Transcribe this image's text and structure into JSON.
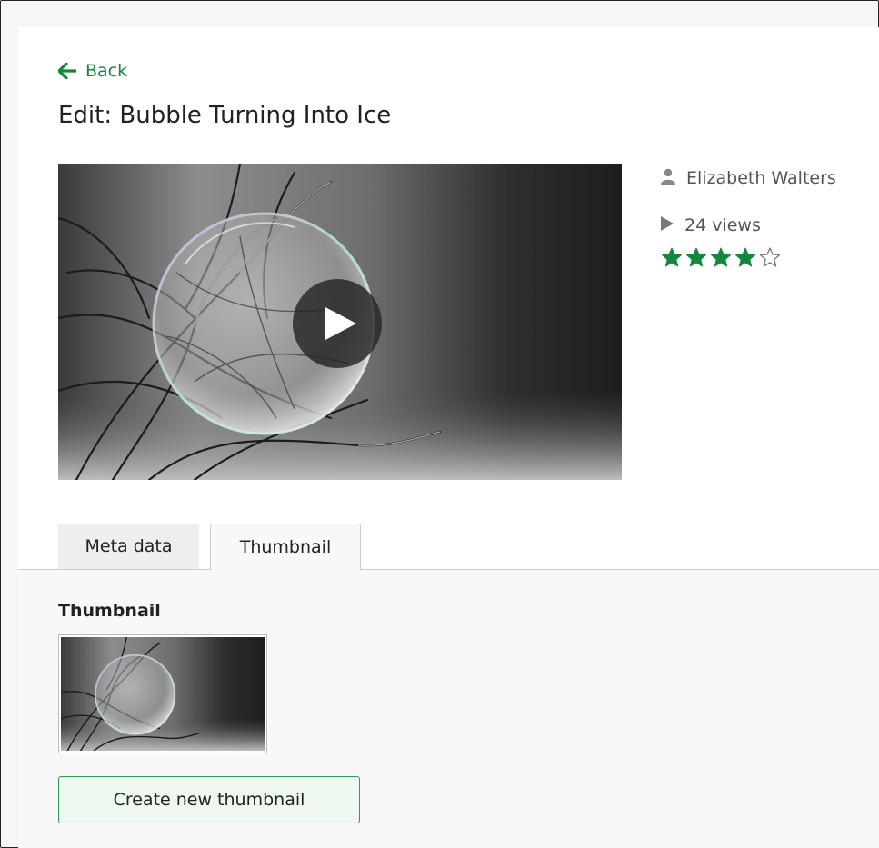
{
  "nav": {
    "back_label": "Back"
  },
  "page": {
    "title": "Edit: Bubble Turning Into Ice"
  },
  "video": {
    "author": "Elizabeth Walters",
    "views": "24 views",
    "rating": 4,
    "rating_max": 5
  },
  "tabs": [
    {
      "label": "Meta data",
      "active": false
    },
    {
      "label": "Thumbnail",
      "active": true
    }
  ],
  "thumbnail_panel": {
    "heading": "Thumbnail",
    "create_button_label": "Create new thumbnail"
  },
  "colors": {
    "accent_green": "#14873d",
    "star_green": "#14873d",
    "muted_text": "#555555"
  },
  "icons": {
    "back": "arrow-left-icon",
    "author": "user-icon",
    "views": "play-small-icon",
    "play": "play-icon",
    "star": "star-icon"
  }
}
